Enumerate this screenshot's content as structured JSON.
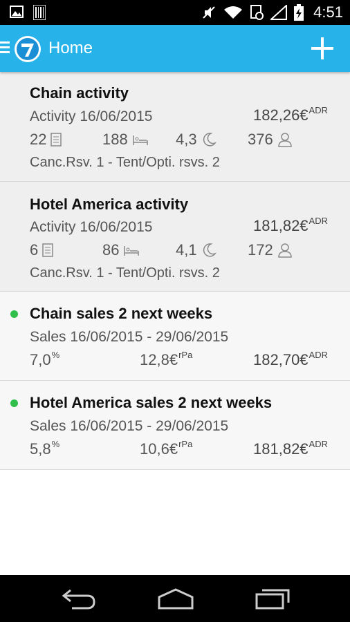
{
  "status_bar": {
    "time": "4:51",
    "icons": [
      "image-icon",
      "barcode-icon",
      "mute-icon",
      "wifi-icon",
      "sync-icon",
      "signal-icon",
      "battery-icon"
    ]
  },
  "header": {
    "title": "Home",
    "accent_color": "#27b3ea"
  },
  "cards": [
    {
      "title": "Chain activity",
      "date_line": "Activity 16/06/2015",
      "amount": "182,26€",
      "amount_sup": "ADR",
      "stats": [
        "22",
        "188",
        "4,3",
        "376"
      ],
      "footer": "Canc.Rsv. 1 - Tent/Opti. rsvs. 2"
    },
    {
      "title": "Hotel America activity",
      "date_line": "Activity 16/06/2015",
      "amount": "181,82€",
      "amount_sup": "ADR",
      "stats": [
        "6",
        "86",
        "4,1",
        "172"
      ],
      "footer": "Canc.Rsv. 1 - Tent/Opti. rsvs. 2"
    },
    {
      "title": "Chain sales 2 next weeks",
      "date_line": "Sales 16/06/2015 - 29/06/2015",
      "pct": "7,0",
      "pct_sup": "%",
      "rpa": "12,8€",
      "rpa_sup": "rPa",
      "amount": "182,70€",
      "amount_sup": "ADR",
      "indicator_color": "#2fbf4a"
    },
    {
      "title": "Hotel America sales 2 next weeks",
      "date_line": "Sales 16/06/2015 - 29/06/2015",
      "pct": "5,8",
      "pct_sup": "%",
      "rpa": "10,6€",
      "rpa_sup": "rPa",
      "amount": "181,82€",
      "amount_sup": "ADR",
      "indicator_color": "#2fbf4a"
    }
  ],
  "nav_bar": {
    "buttons": [
      "back-icon",
      "home-icon",
      "recents-icon"
    ]
  }
}
